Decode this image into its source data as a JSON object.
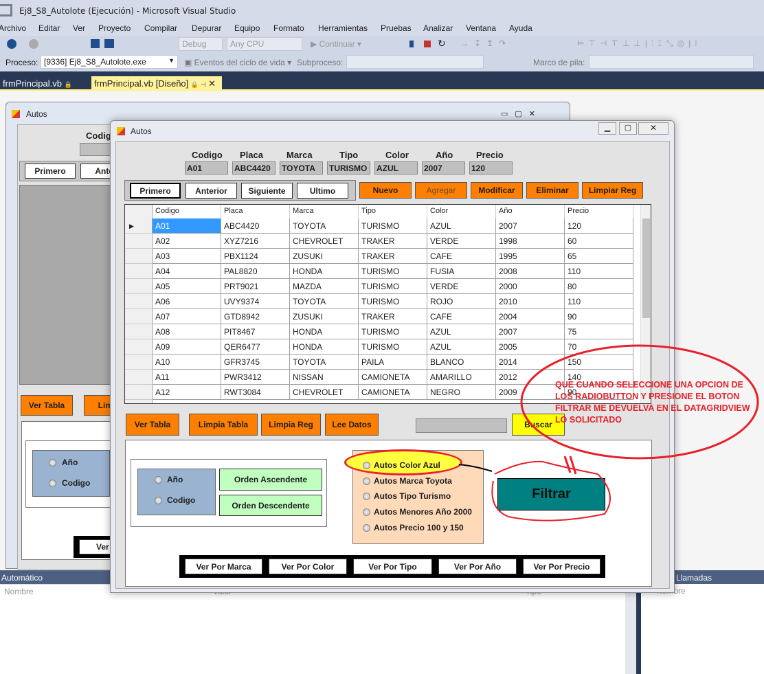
{
  "vs": {
    "title": "Ej8_S8_Autolote (Ejecución) - Microsoft Visual Studio",
    "menu": [
      "Archivo",
      "Editar",
      "Ver",
      "Proyecto",
      "Compilar",
      "Depurar",
      "Equipo",
      "Formato",
      "Herramientas",
      "Pruebas",
      "Analizar",
      "Ventana",
      "Ayuda"
    ],
    "toolbar": {
      "config": "Debug",
      "platform": "Any CPU",
      "continue": "Continuar"
    },
    "toolbar2": {
      "process_label": "Proceso:",
      "process_value": "[9336] Ej8_S8_Autolote.exe",
      "lifecycle": "Eventos del ciclo de vida",
      "thread_label": "Subproceso:",
      "stack_label": "Marco de pila:"
    },
    "tabs": [
      {
        "label": "frmPrincipal.vb"
      },
      {
        "label": "frmPrincipal.vb [Diseño]",
        "active": true
      }
    ],
    "panes": {
      "autos_title": "Automático",
      "autos_col": "Nombre",
      "autos_col2": "Valor",
      "autos_col3": "Tipo",
      "calls_title": "Llamadas",
      "calls_col": "Nombre"
    }
  },
  "designer_form": {
    "title": "Autos",
    "codigo_label": "Codigo",
    "primero": "Primero",
    "anterior": "Anter",
    "ver_tabla": "Ver Tabla",
    "limpia": "Limp",
    "ano": "Año",
    "codigo": "Codigo",
    "ver_p": "Ver P"
  },
  "form": {
    "title": "Autos",
    "labels": [
      "Codigo",
      "Placa",
      "Marca",
      "Tipo",
      "Color",
      "Año",
      "Precio"
    ],
    "values": [
      "A01",
      "ABC4420",
      "TOYOTA",
      "TURISMO",
      "AZUL",
      "2007",
      "120"
    ],
    "nav": [
      "Primero",
      "Anterior",
      "Siguiente",
      "Ultimo"
    ],
    "actions": [
      "Nuevo",
      "Agregar",
      "Modificar",
      "Eliminar",
      "Limpiar Reg"
    ],
    "grid": {
      "columns": [
        "Codigo",
        "Placa",
        "Marca",
        "Tipo",
        "Color",
        "Año",
        "Precio"
      ],
      "rows": [
        [
          "A01",
          "ABC4420",
          "TOYOTA",
          "TURISMO",
          "AZUL",
          "2007",
          "120"
        ],
        [
          "A02",
          "XYZ7216",
          "CHEVROLET",
          "TRAKER",
          "VERDE",
          "1998",
          "60"
        ],
        [
          "A03",
          "PBX1124",
          "ZUSUKI",
          "TRAKER",
          "CAFE",
          "1995",
          "65"
        ],
        [
          "A04",
          "PAL8820",
          "HONDA",
          "TURISMO",
          "FUSIA",
          "2008",
          "110"
        ],
        [
          "A05",
          "PRT9021",
          "MAZDA",
          "TURISMO",
          "VERDE",
          "2000",
          "80"
        ],
        [
          "A06",
          "UVY9374",
          "TOYOTA",
          "TURISMO",
          "ROJO",
          "2010",
          "110"
        ],
        [
          "A07",
          "GTD8942",
          "ZUSUKI",
          "TRAKER",
          "CAFE",
          "2004",
          "90"
        ],
        [
          "A08",
          "PIT8467",
          "HONDA",
          "TURISMO",
          "AZUL",
          "2007",
          "75"
        ],
        [
          "A09",
          "QER6477",
          "HONDA",
          "TURISMO",
          "AZUL",
          "2005",
          "70"
        ],
        [
          "A10",
          "GFR3745",
          "TOYOTA",
          "PAILA",
          "BLANCO",
          "2014",
          "150"
        ],
        [
          "A11",
          "PWR3412",
          "NISSAN",
          "CAMIONETA",
          "AMARILLO",
          "2012",
          "140"
        ],
        [
          "A12",
          "RWT3084",
          "CHEVROLET",
          "CAMIONETA",
          "NEGRO",
          "2009",
          "90"
        ]
      ]
    },
    "buttons2": [
      "Ver Tabla",
      "Limpia Tabla",
      "Limpia Reg",
      "Lee Datos"
    ],
    "search_value": "",
    "buscar": "Buscar",
    "order_radios": [
      "Año",
      "Codigo"
    ],
    "order_buttons": [
      "Orden Ascendente",
      "Orden Descendente"
    ],
    "filter_radios": [
      "Autos Color Azul",
      "Autos Marca Toyota",
      "Autos Tipo Turismo",
      "Autos Menores Año 2000",
      "Autos Precio 100 y 150"
    ],
    "filtrar": "Filtrar",
    "view_buttons": [
      "Ver Por Marca",
      "Ver Por Color",
      "Ver Por Tipo",
      "Ver Por Año",
      "Ver Por Precio"
    ]
  },
  "annotation": {
    "text": "QUE CUANDO SELECCIONE UNA OPCION DE LOS RADIOBUTTON Y PRESIONE EL BOTON FILTRAR ME DEVUELVA EN EL DATAGRIDVIEW LO SOLICITADO",
    "color": "#e8202a"
  },
  "colors": {
    "orange": "#ff7f00",
    "yellow": "#ffff00",
    "teal": "#008080",
    "green": "#c0ffc0",
    "blue_panel": "#9ab3d0",
    "peach": "#ffdab9",
    "selection": "#3399ff"
  }
}
